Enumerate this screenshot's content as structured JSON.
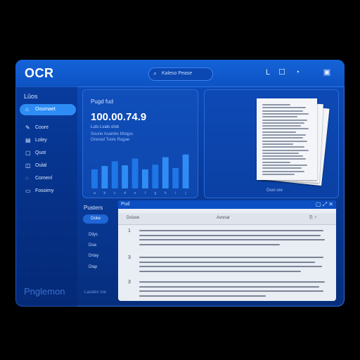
{
  "app": {
    "logo": "OCR"
  },
  "search": {
    "placeholder": "Kaleso Pease"
  },
  "top_icons": [
    "L",
    "☐",
    "◔",
    "▣"
  ],
  "sidebar": {
    "title": "Lūos",
    "items": [
      {
        "label": "Ooumaet",
        "active": true
      },
      {
        "label": "Coore"
      },
      {
        "label": "Loley"
      },
      {
        "label": "Quot"
      },
      {
        "label": "Oulal"
      },
      {
        "label": "Comenl"
      },
      {
        "label": "Fosoimy"
      }
    ],
    "watermark": "Pnglemon",
    "footer": "Lasalec roe"
  },
  "stats": {
    "title": "Pugd fud",
    "value": "100.00.74.9",
    "subtitle": "Luts Lvalo olsb",
    "lines": [
      "Soune Asanles Moqpu",
      "Oreoad Toole Ragae"
    ]
  },
  "doc_panel": {
    "caption": "Ouoi ore"
  },
  "subnav": {
    "title": "Pusters",
    "button": "Ooke",
    "items": [
      "Dilys",
      "Doa",
      "Drtay",
      "Dlap"
    ]
  },
  "result": {
    "title": "Pud",
    "tabs": [
      "Dsluve",
      "Avonar"
    ],
    "paragraphs": [
      "1",
      "3",
      "3"
    ]
  },
  "chart_data": {
    "type": "bar",
    "categories": [
      "a",
      "b",
      "c",
      "d",
      "e",
      "f",
      "g",
      "h",
      "i",
      "j"
    ],
    "values": [
      28,
      33,
      40,
      34,
      44,
      28,
      35,
      46,
      30,
      50
    ],
    "ylim": [
      0,
      60
    ]
  }
}
